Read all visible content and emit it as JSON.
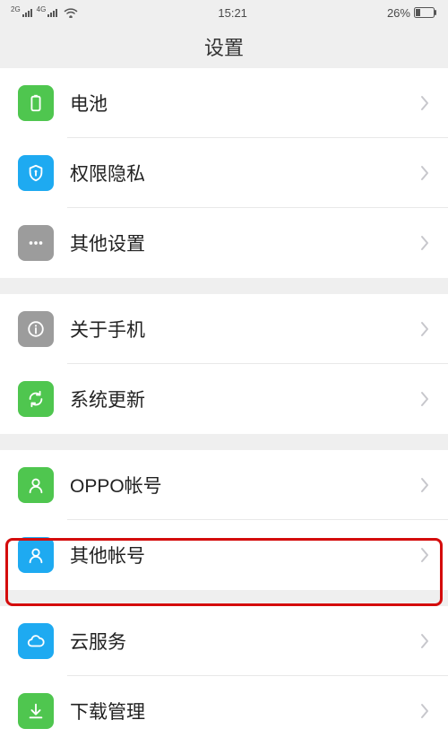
{
  "status": {
    "signal_2g": "2G",
    "signal_4g": "4G",
    "time": "15:21",
    "battery_pct": "26%"
  },
  "header": {
    "title": "设置"
  },
  "groups": [
    {
      "items": [
        {
          "id": "battery",
          "label": "电池",
          "icon": "battery-icon",
          "color": "#4fc64f"
        },
        {
          "id": "privacy",
          "label": "权限隐私",
          "icon": "shield-icon",
          "color": "#1eaaf1"
        },
        {
          "id": "other",
          "label": "其他设置",
          "icon": "dots-icon",
          "color": "#9c9c9c"
        }
      ]
    },
    {
      "items": [
        {
          "id": "about",
          "label": "关于手机",
          "icon": "info-icon",
          "color": "#9c9c9c"
        },
        {
          "id": "update",
          "label": "系统更新",
          "icon": "refresh-icon",
          "color": "#4fc64f"
        }
      ]
    },
    {
      "items": [
        {
          "id": "oppo",
          "label": "OPPO帐号",
          "icon": "user-icon",
          "color": "#4fc64f"
        },
        {
          "id": "accounts",
          "label": "其他帐号",
          "icon": "user-icon",
          "color": "#1eaaf1"
        }
      ]
    },
    {
      "items": [
        {
          "id": "cloud",
          "label": "云服务",
          "icon": "cloud-icon",
          "color": "#1eaaf1",
          "highlight": true
        },
        {
          "id": "download",
          "label": "下载管理",
          "icon": "download-icon",
          "color": "#4fc64f"
        }
      ]
    }
  ]
}
